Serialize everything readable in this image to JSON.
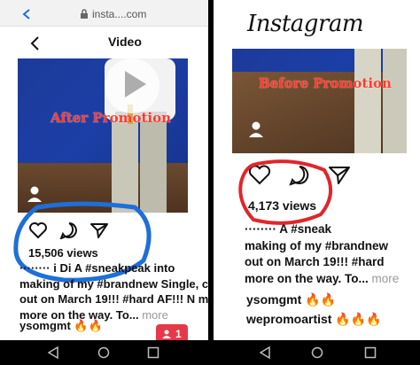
{
  "left": {
    "url": "insta....com",
    "nav_title": "Video",
    "promo_label": "After Promotion",
    "views": "15,506 views",
    "caption": {
      "line1_prefix": "········ i ",
      "line1_rest": "Di A ",
      "line1_tag": "#sneakpeak",
      "line1_end": " into",
      "line2": "making of my ",
      "line2_tag": "#brandnew",
      "line2_end": " Single, c",
      "line3": "out on March 19!!! ",
      "line3_tag": "#hard",
      "line3_end": " AF!!! N m",
      "line4": "more on the way. To... ",
      "more": "more"
    },
    "comment_user": "ysomgmt",
    "comment_emoji": "🔥🔥",
    "notif_count": "1"
  },
  "right": {
    "logo": "Instagram",
    "promo_label": "Before Promotion",
    "views": "4,173 views",
    "caption": {
      "line1_prefix": "········ ",
      "line1_rest": "A ",
      "line1_tag": "#sneak",
      "line2": "making of my ",
      "line2_tag": "#brandnew",
      "line3": "out on March 19!!! ",
      "line3_tag": "#hard",
      "line4": "more on the way. To... ",
      "more": "more"
    },
    "comments": [
      {
        "user": "ysomgmt",
        "emoji": "🔥🔥"
      },
      {
        "user": "wepromoartist",
        "emoji": "🔥🔥🔥"
      }
    ]
  },
  "colors": {
    "left_highlight": "#1e6fd9",
    "right_highlight": "#e0262b",
    "promo_text": "#ff3b2f"
  },
  "icons": [
    "back-chevron-icon",
    "lock-icon",
    "play-icon",
    "heart-icon",
    "comment-icon",
    "share-icon",
    "profile-icon",
    "android-back-icon",
    "android-home-icon",
    "android-recents-icon"
  ]
}
